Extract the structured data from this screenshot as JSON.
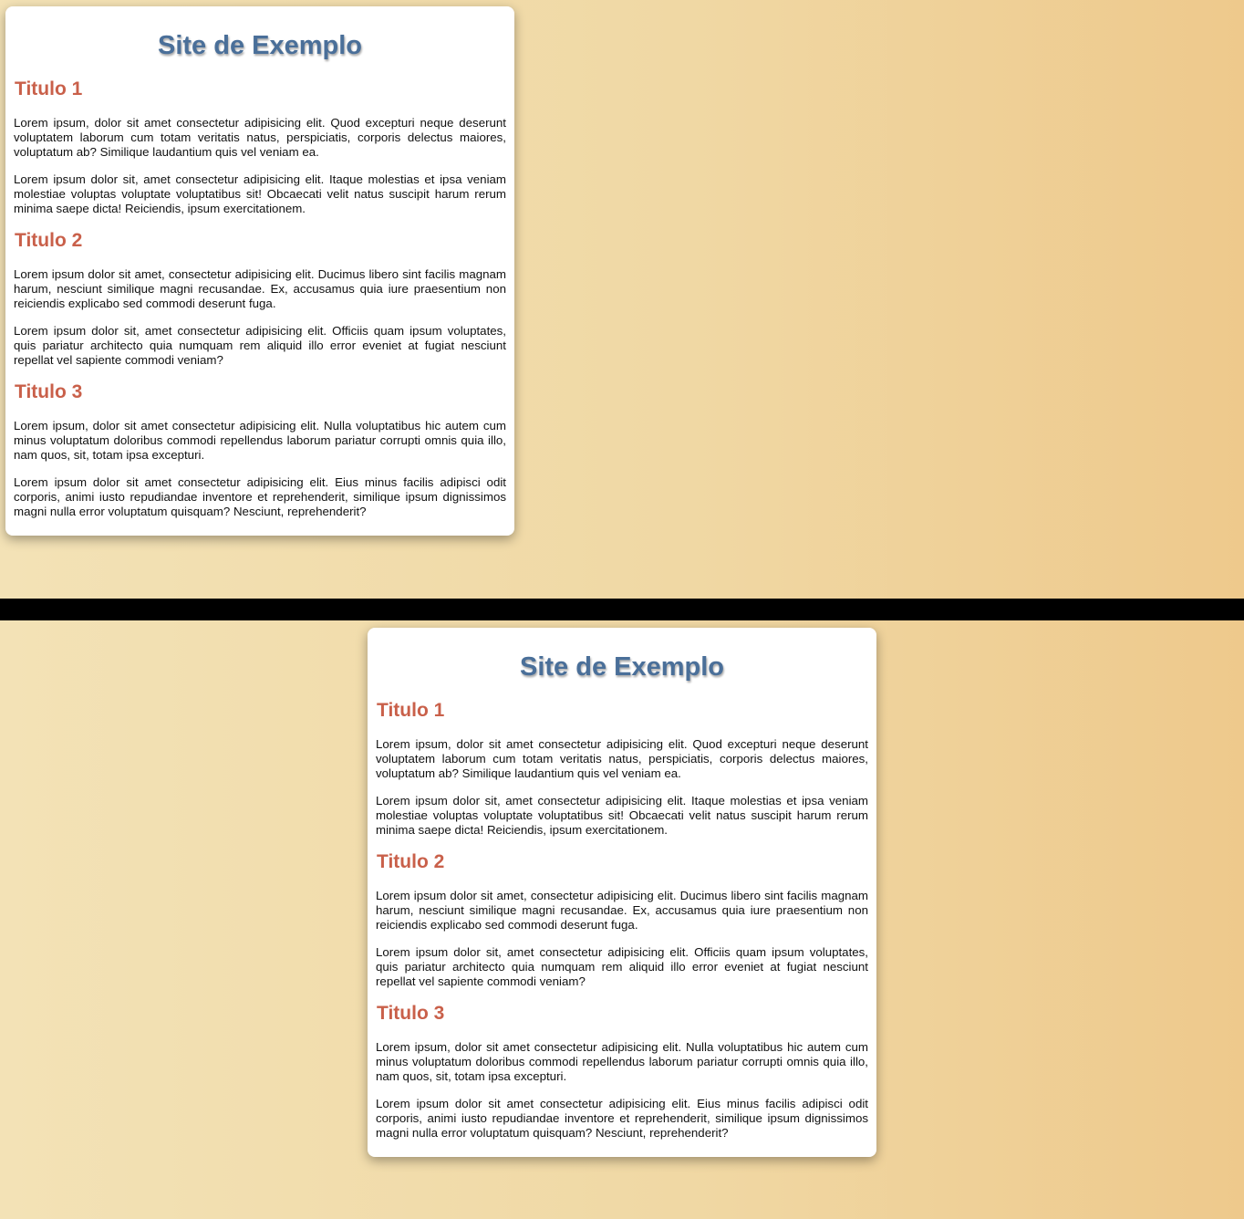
{
  "site_title": "Site de Exemplo",
  "sections": [
    {
      "title": "Titulo 1",
      "paragraphs": [
        "Lorem ipsum, dolor sit amet consectetur adipisicing elit. Quod excepturi neque deserunt voluptatem laborum cum totam veritatis natus, perspiciatis, corporis delectus maiores, voluptatum ab? Similique laudantium quis vel veniam ea.",
        "Lorem ipsum dolor sit, amet consectetur adipisicing elit. Itaque molestias et ipsa veniam molestiae voluptas voluptate voluptatibus sit! Obcaecati velit natus suscipit harum rerum minima saepe dicta! Reiciendis, ipsum exercitationem."
      ]
    },
    {
      "title": "Titulo 2",
      "paragraphs": [
        "Lorem ipsum dolor sit amet, consectetur adipisicing elit. Ducimus libero sint facilis magnam harum, nesciunt similique magni recusandae. Ex, accusamus quia iure praesentium non reiciendis explicabo sed commodi deserunt fuga.",
        "Lorem ipsum dolor sit, amet consectetur adipisicing elit. Officiis quam ipsum voluptates, quis pariatur architecto quia numquam rem aliquid illo error eveniet at fugiat nesciunt repellat vel sapiente commodi veniam?"
      ]
    },
    {
      "title": "Titulo 3",
      "paragraphs": [
        "Lorem ipsum, dolor sit amet consectetur adipisicing elit. Nulla voluptatibus hic autem cum minus voluptatum doloribus commodi repellendus laborum pariatur corrupti omnis quia illo, nam quos, sit, totam ipsa excepturi.",
        "Lorem ipsum dolor sit amet consectetur adipisicing elit. Eius minus facilis adipisci odit corporis, animi iusto repudiandae inventore et reprehenderit, similique ipsum dignissimos magni nulla error voluptatum quisquam? Nesciunt, reprehenderit?"
      ]
    }
  ],
  "colors": {
    "title": "#4a6f99",
    "section_title": "#c9604a",
    "background_start": "#f3e2b6",
    "background_end": "#eec98c",
    "divider": "#000000"
  }
}
